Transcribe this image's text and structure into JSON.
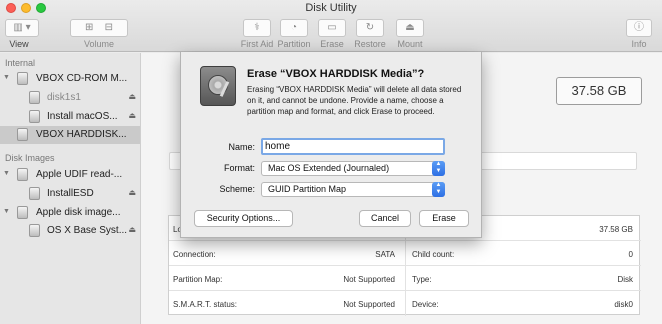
{
  "window": {
    "title": "Disk Utility"
  },
  "toolbar": {
    "view_label": "View",
    "volume_label": "Volume",
    "first_aid_label": "First Aid",
    "partition_label": "Partition",
    "erase_label": "Erase",
    "restore_label": "Restore",
    "mount_label": "Mount",
    "info_label": "Info"
  },
  "sidebar": {
    "internal_header": "Internal",
    "disk_images_header": "Disk Images",
    "items": [
      {
        "label": "VBOX CD-ROM M...",
        "icon": "optical-drive-icon"
      },
      {
        "label": "disk1s1",
        "icon": "volume-icon"
      },
      {
        "label": "Install macOS...",
        "icon": "volume-icon"
      },
      {
        "label": "VBOX HARDDISK...",
        "icon": "hard-disk-icon"
      },
      {
        "label": "Apple UDIF read-...",
        "icon": "disk-image-icon"
      },
      {
        "label": "InstallESD",
        "icon": "volume-icon"
      },
      {
        "label": "Apple disk image...",
        "icon": "disk-image-icon"
      },
      {
        "label": "OS X Base Syst...",
        "icon": "volume-icon"
      }
    ]
  },
  "main": {
    "capacity": "37.58 GB",
    "info": {
      "left": [
        {
          "label": "Lo",
          "value": ""
        },
        {
          "label": "Connection:",
          "value": "SATA"
        },
        {
          "label": "Partition Map:",
          "value": "Not Supported"
        },
        {
          "label": "S.M.A.R.T. status:",
          "value": "Not Supported"
        }
      ],
      "right": [
        {
          "label": "",
          "value": "37.58 GB"
        },
        {
          "label": "Child count:",
          "value": "0"
        },
        {
          "label": "Type:",
          "value": "Disk"
        },
        {
          "label": "Device:",
          "value": "disk0"
        }
      ]
    }
  },
  "dialog": {
    "title": "Erase “VBOX HARDDISK Media”?",
    "message": "Erasing “VBOX HARDDISK Media” will delete all data stored on it, and cannot be undone. Provide a name, choose a partition map and format, and click Erase to proceed.",
    "name_label": "Name:",
    "name_value": "home",
    "format_label": "Format:",
    "format_value": "Mac OS Extended (Journaled)",
    "scheme_label": "Scheme:",
    "scheme_value": "GUID Partition Map",
    "security_button": "Security Options...",
    "cancel_button": "Cancel",
    "erase_button": "Erase"
  }
}
